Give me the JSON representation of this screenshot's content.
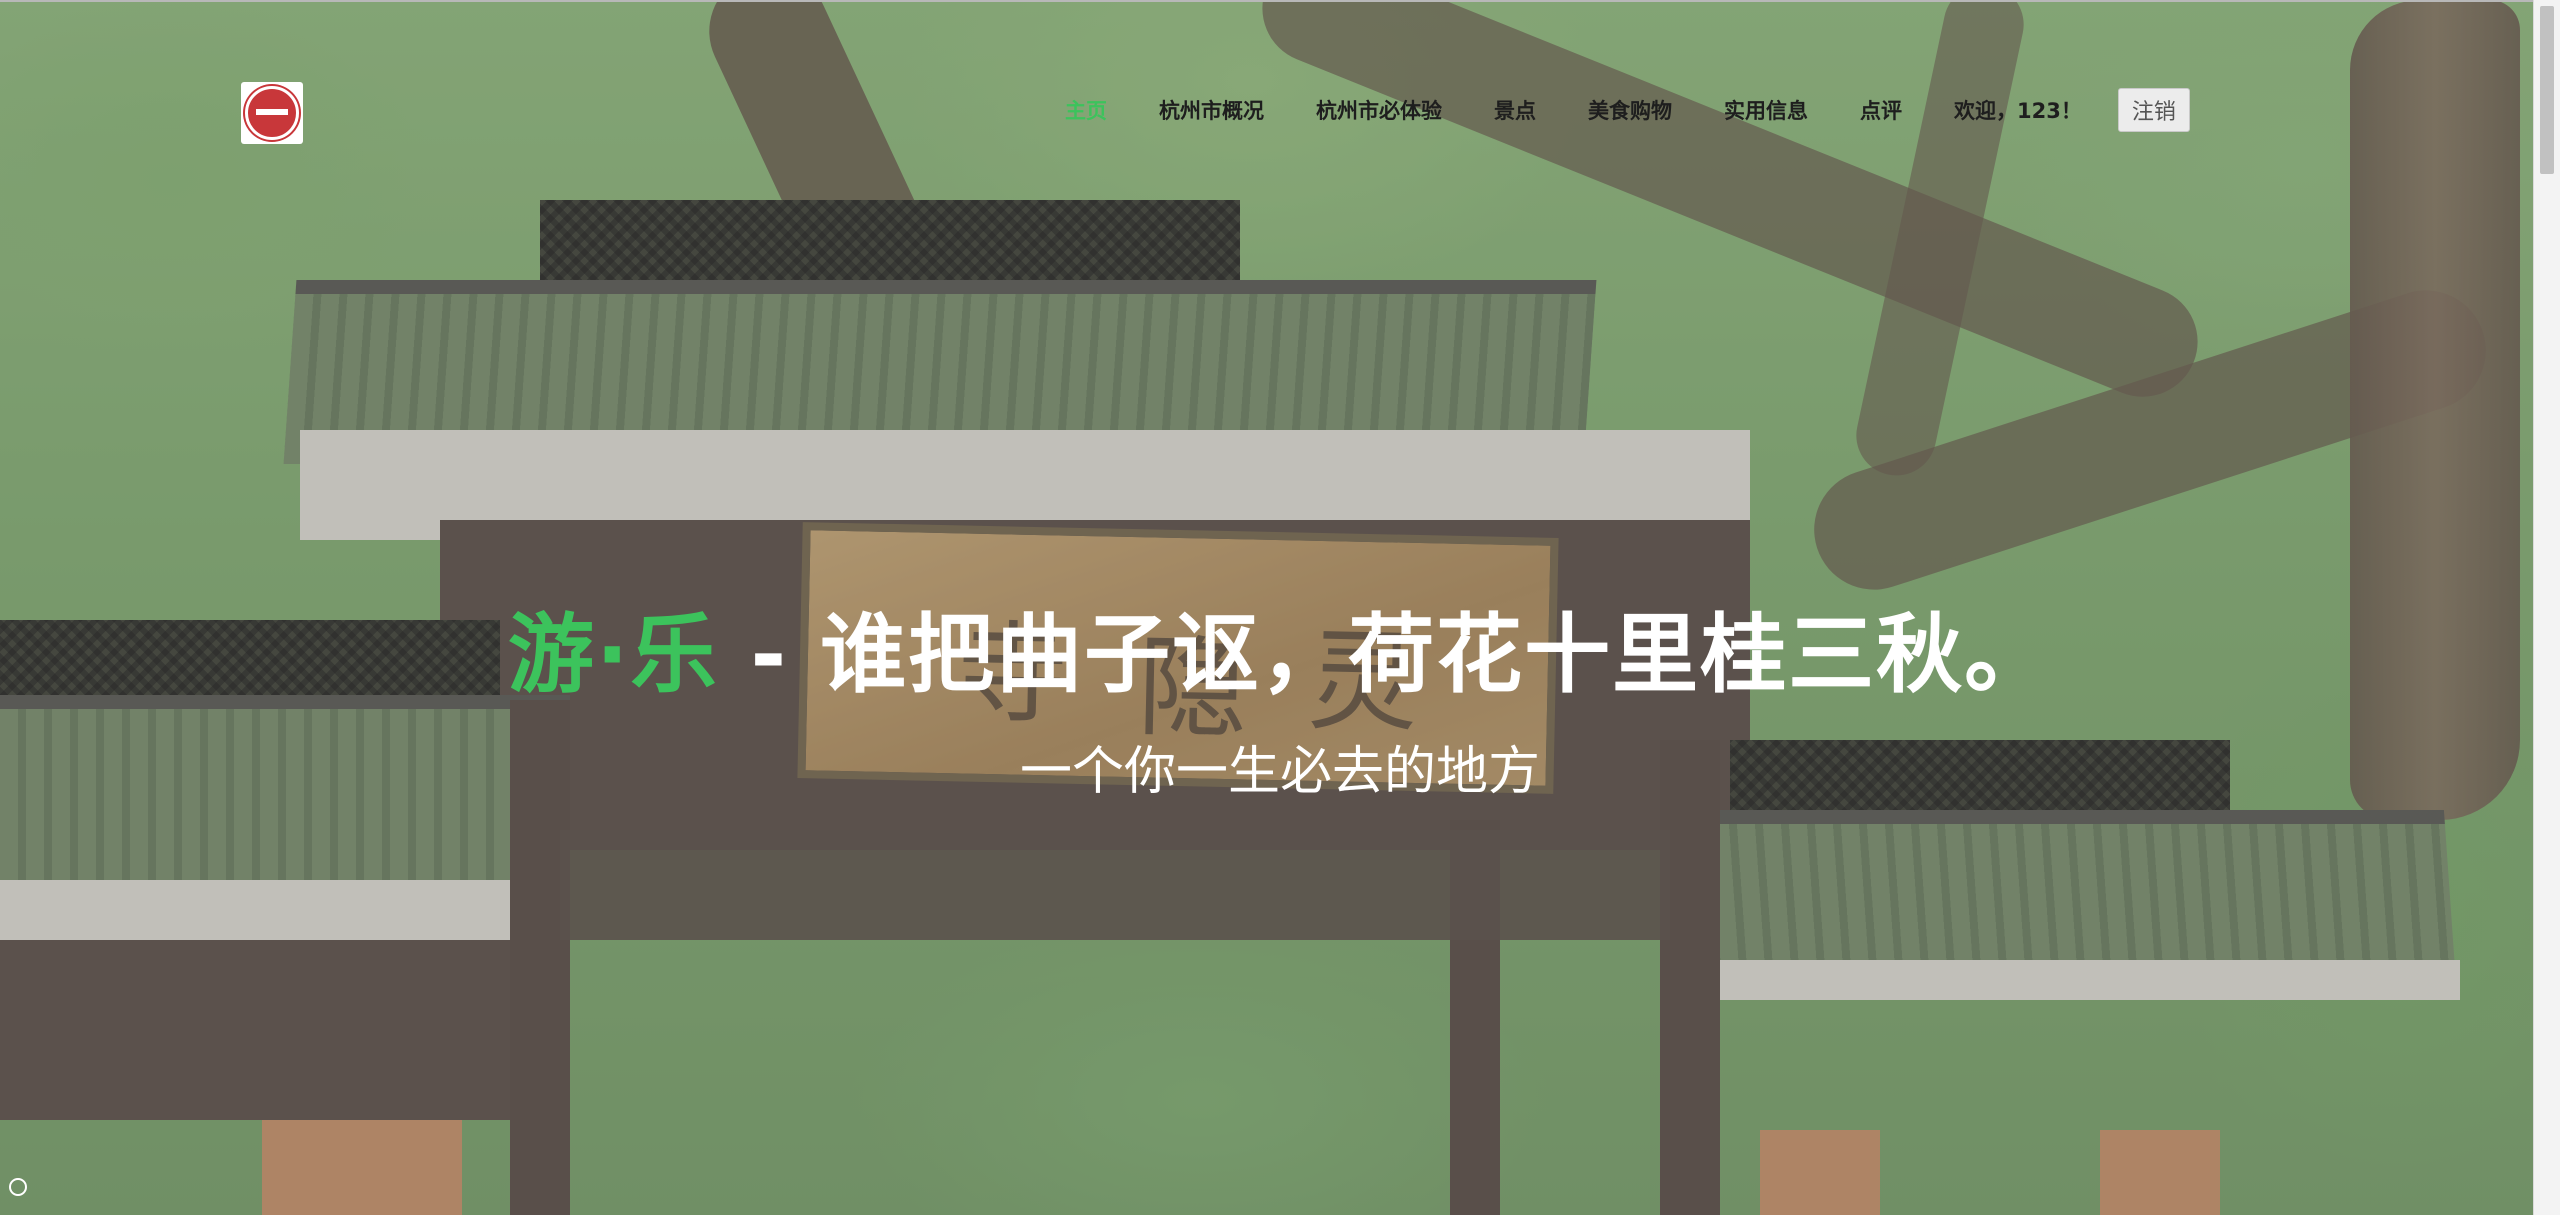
{
  "header": {
    "logo_icon": "city-emblem-logo",
    "nav": [
      {
        "label": "主页",
        "active": true
      },
      {
        "label": "杭州市概况",
        "active": false
      },
      {
        "label": "杭州市必体验",
        "active": false
      },
      {
        "label": "景点",
        "active": false
      },
      {
        "label": "美食购物",
        "active": false
      },
      {
        "label": "实用信息",
        "active": false
      },
      {
        "label": "点评",
        "active": false
      }
    ],
    "welcome": "欢迎，123！",
    "logout_label": "注销"
  },
  "hero": {
    "title_accent": "游·乐",
    "title_rest": " - 谁把曲子讴，荷花十里桂三秋。",
    "subtitle": "一个你一生必去的地方"
  },
  "colors": {
    "accent_green": "#3cc35c",
    "nav_text": "#1e1e1e",
    "hero_text": "#ffffff"
  }
}
